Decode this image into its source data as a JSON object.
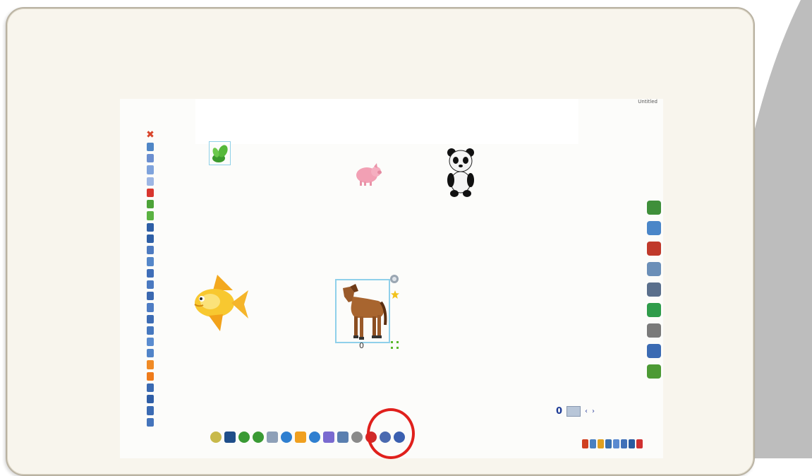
{
  "colors": {
    "background": "#ffffff",
    "frame": "#f8f5ed",
    "screen": "#fcfcfa",
    "gray_wedge": "#bdbdbd",
    "highlight": "#e0201c",
    "selection": "#8fd0ea"
  },
  "window": {
    "corner_label": "Untitled",
    "page_indicator": "0",
    "nav_prev": "‹",
    "nav_next": "›"
  },
  "selection": {
    "label": "0"
  },
  "left_toolbar": {
    "close_glyph": "✖",
    "tools": [
      {
        "icon": "select-icon",
        "color": "#4f86c6"
      },
      {
        "icon": "zoom-icon",
        "color": "#6b8fd0"
      },
      {
        "icon": "copy-icon",
        "color": "#7fa3dc"
      },
      {
        "icon": "paste-icon",
        "color": "#9db6e4"
      },
      {
        "icon": "delete-icon",
        "color": "#d8362e"
      },
      {
        "icon": "pen-green-icon",
        "color": "#4ca337"
      },
      {
        "icon": "pen-green2-icon",
        "color": "#5ab241"
      },
      {
        "icon": "align-icon",
        "color": "#2e5fa6"
      },
      {
        "icon": "align2-icon",
        "color": "#2e5fa6"
      },
      {
        "icon": "layer-icon",
        "color": "#4d7ac0"
      },
      {
        "icon": "layer2-icon",
        "color": "#5587c9"
      },
      {
        "icon": "group-icon",
        "color": "#3f6eb8"
      },
      {
        "icon": "ungroup-icon",
        "color": "#4a79c0"
      },
      {
        "icon": "lock-icon",
        "color": "#3a68b0"
      },
      {
        "icon": "unlock-icon",
        "color": "#4e7dc4"
      },
      {
        "icon": "flip-icon",
        "color": "#3d6cb4"
      },
      {
        "icon": "rotate-icon",
        "color": "#4678bf"
      },
      {
        "icon": "front-icon",
        "color": "#5a8ccf"
      },
      {
        "icon": "back-icon",
        "color": "#5184c8"
      },
      {
        "icon": "star-icon",
        "color": "#f08a24"
      },
      {
        "icon": "orange-icon",
        "color": "#ef7b1a"
      },
      {
        "icon": "link-icon",
        "color": "#3a6ab2"
      },
      {
        "icon": "sound-icon",
        "color": "#2f5ea6"
      },
      {
        "icon": "text-icon",
        "color": "#3b6bb3"
      },
      {
        "icon": "props-icon",
        "color": "#4474bb"
      }
    ]
  },
  "right_toolbar": {
    "tools": [
      {
        "icon": "gallery-icon",
        "color": "#3f8f3a"
      },
      {
        "icon": "pages-icon",
        "color": "#4a86c8"
      },
      {
        "icon": "record-icon",
        "color": "#c0392b"
      },
      {
        "icon": "audio-icon",
        "color": "#6b8fb8"
      },
      {
        "icon": "video-icon",
        "color": "#5a6f8c"
      },
      {
        "icon": "globe-icon",
        "color": "#2f9c4a"
      },
      {
        "icon": "camera-icon",
        "color": "#7a7a7a"
      },
      {
        "icon": "tools-icon",
        "color": "#3b6bb3"
      },
      {
        "icon": "bin-icon",
        "color": "#4c9a34"
      }
    ]
  },
  "bottom_toolbar": {
    "tools": [
      {
        "icon": "light-bulb-icon",
        "color": "#c8b94a",
        "shape": "round"
      },
      {
        "icon": "screen-icon",
        "color": "#1f4e8a",
        "shape": "square"
      },
      {
        "icon": "back-green-icon",
        "color": "#3a9a34",
        "shape": "round"
      },
      {
        "icon": "forward-green-icon",
        "color": "#3a9a34",
        "shape": "round"
      },
      {
        "icon": "camera-small-icon",
        "color": "#8ea0b8",
        "shape": "square"
      },
      {
        "icon": "prev-page-icon",
        "color": "#2f7fd0",
        "shape": "round"
      },
      {
        "icon": "new-page-icon",
        "color": "#f0a020",
        "shape": "square"
      },
      {
        "icon": "next-page-icon",
        "color": "#2f7fd0",
        "shape": "round"
      },
      {
        "icon": "book-icon",
        "color": "#7a6ad0",
        "shape": "square"
      },
      {
        "icon": "highlighter-icon",
        "color": "#5a7fb0",
        "shape": "square"
      },
      {
        "icon": "pen-icon",
        "color": "#8a8a8a",
        "shape": "round"
      },
      {
        "icon": "marker-red-icon",
        "color": "#d02a2a",
        "shape": "round"
      },
      {
        "icon": "brush-icon",
        "color": "#4a6ab0",
        "shape": "round"
      },
      {
        "icon": "mouse-icon",
        "color": "#3a5fb0",
        "shape": "round"
      }
    ]
  },
  "bottom_right_tools": [
    {
      "icon": "tool-a-icon",
      "color": "#d04020"
    },
    {
      "icon": "tool-b-icon",
      "color": "#4a80c0"
    },
    {
      "icon": "tool-c-icon",
      "color": "#e0a020"
    },
    {
      "icon": "tool-d-icon",
      "color": "#3a70b0"
    },
    {
      "icon": "tool-e-icon",
      "color": "#5a8ad0"
    },
    {
      "icon": "tool-f-icon",
      "color": "#4070b8"
    },
    {
      "icon": "tool-g-icon",
      "color": "#2a5aa0"
    },
    {
      "icon": "tool-h-icon",
      "color": "#d03030"
    }
  ]
}
